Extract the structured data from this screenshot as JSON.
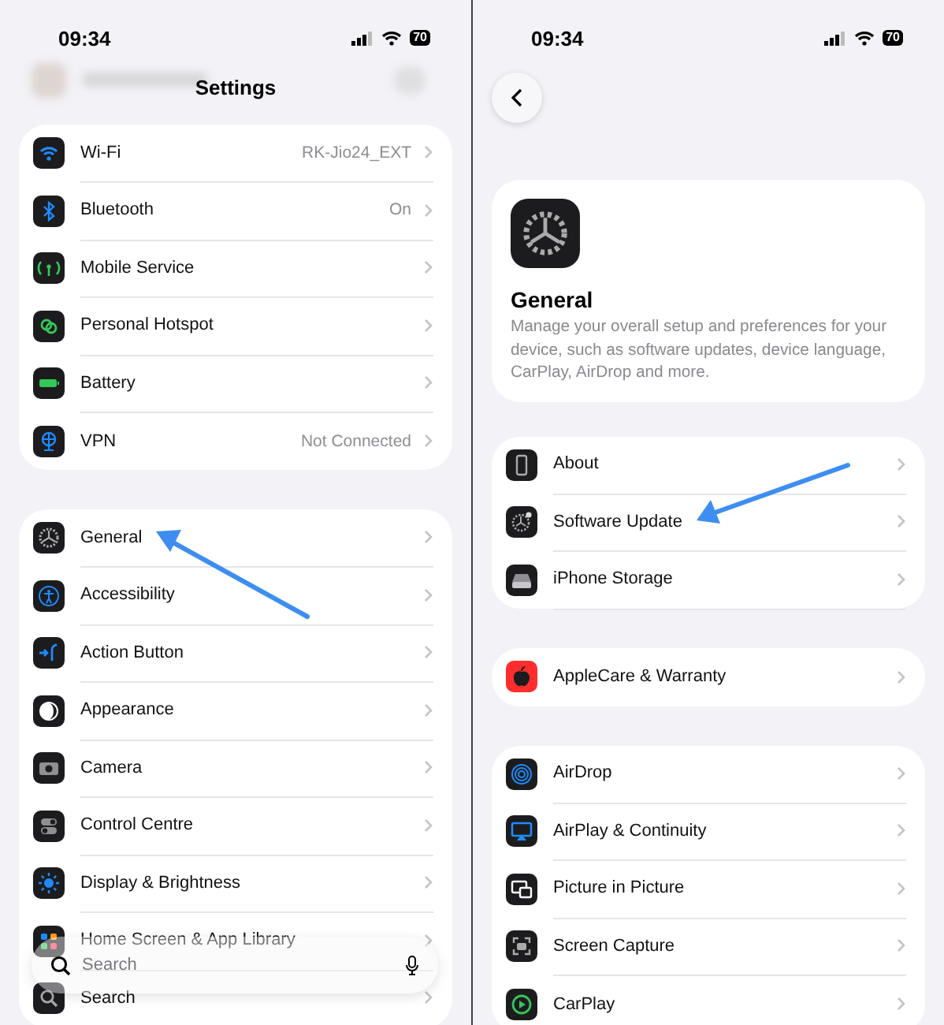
{
  "panels": [
    {
      "status_bar": {
        "time": "09:34",
        "battery": "70"
      },
      "title": "Settings",
      "groups": [
        {
          "rows": [
            {
              "kind": "wifi",
              "label": "Wi-Fi",
              "value": "RK-Jio24_EXT"
            },
            {
              "kind": "bluetooth",
              "label": "Bluetooth",
              "value": "On"
            },
            {
              "kind": "antenna",
              "label": "Mobile Service"
            },
            {
              "kind": "hotspot",
              "label": "Personal Hotspot"
            },
            {
              "kind": "battery",
              "label": "Battery"
            },
            {
              "kind": "globe",
              "label": "VPN",
              "value": "Not Connected"
            }
          ]
        },
        {
          "rows": [
            {
              "kind": "gear",
              "label": "General",
              "arrow": true
            },
            {
              "kind": "person",
              "label": "Accessibility"
            },
            {
              "kind": "action",
              "label": "Action Button"
            },
            {
              "kind": "contrast",
              "label": "Appearance"
            },
            {
              "kind": "camera",
              "label": "Camera"
            },
            {
              "kind": "toggles",
              "label": "Control Centre"
            },
            {
              "kind": "sun",
              "label": "Display & Brightness"
            },
            {
              "kind": "grid",
              "label": "Home Screen & App Library"
            },
            {
              "kind": "search",
              "label": "Search"
            }
          ]
        }
      ],
      "search": {
        "placeholder": "Search"
      }
    },
    {
      "status_bar": {
        "time": "09:34",
        "battery": "70"
      },
      "back": true,
      "header": {
        "title": "General",
        "description": "Manage your overall setup and preferences for your device, such as software updates, device language, CarPlay, AirDrop and more."
      },
      "groups": [
        {
          "rows": [
            {
              "kind": "phone",
              "label": "About"
            },
            {
              "kind": "update",
              "label": "Software Update",
              "arrow": true
            },
            {
              "kind": "storage",
              "label": "iPhone Storage"
            }
          ]
        },
        {
          "rows": [
            {
              "kind": "apple",
              "label": "AppleCare & Warranty"
            }
          ]
        },
        {
          "rows": [
            {
              "kind": "airdrop",
              "label": "AirDrop"
            },
            {
              "kind": "airplay",
              "label": "AirPlay & Continuity"
            },
            {
              "kind": "pip",
              "label": "Picture in Picture"
            },
            {
              "kind": "capture",
              "label": "Screen Capture"
            },
            {
              "kind": "carplay",
              "label": "CarPlay"
            }
          ]
        }
      ]
    }
  ]
}
